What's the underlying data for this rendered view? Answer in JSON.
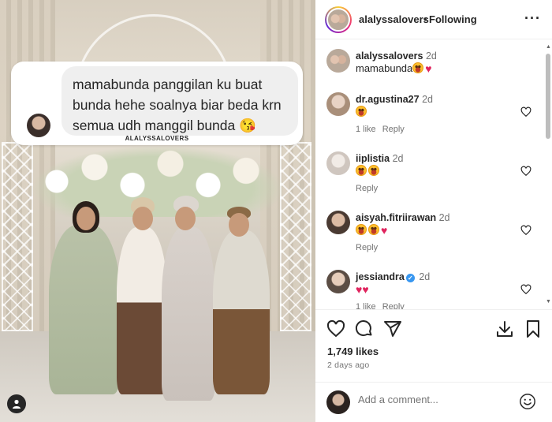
{
  "post": {
    "username": "alalyssalovers",
    "separator": "•",
    "follow_status": "Following",
    "options_icon": "more-horizontal-icon"
  },
  "photo_overlay": {
    "chat_text": "mamabunda panggilan ku buat bunda hehe soalnya biar beda krn semua udh manggil bunda 😘",
    "credit": "ALALYSSALOVERS"
  },
  "comments": [
    {
      "username": "alalyssalovers",
      "time": "2d",
      "text": "mamabunda",
      "emoji": [
        "grinning-hearts-eyes-emoji",
        "red-heart-emoji"
      ],
      "likes": "",
      "reply": ""
    },
    {
      "username": "dr.agustina27",
      "time": "2d",
      "text": "",
      "emoji": [
        "grinning-hearts-eyes-emoji"
      ],
      "likes": "1 like",
      "reply": "Reply"
    },
    {
      "username": "iiplistia",
      "time": "2d",
      "text": "",
      "emoji": [
        "grinning-hearts-eyes-emoji",
        "grinning-hearts-eyes-emoji"
      ],
      "likes": "",
      "reply": "Reply"
    },
    {
      "username": "aisyah.fitriirawan",
      "time": "2d",
      "text": "",
      "emoji": [
        "grinning-hearts-eyes-emoji",
        "grinning-hearts-eyes-emoji",
        "red-heart-emoji"
      ],
      "likes": "",
      "reply": "Reply"
    },
    {
      "username": "jessiandra",
      "time": "2d",
      "text": "",
      "emoji": [
        "red-heart-emoji",
        "red-heart-emoji"
      ],
      "likes": "1 like",
      "reply": "Reply",
      "verified": true
    }
  ],
  "actions": {
    "likes": "1,749 likes",
    "date": "2 days ago"
  },
  "comment_box": {
    "placeholder": "Add a comment..."
  },
  "colors": {
    "text": "#262626",
    "muted": "#737373",
    "heart": "#e0245e",
    "verified": "#3897f0"
  }
}
